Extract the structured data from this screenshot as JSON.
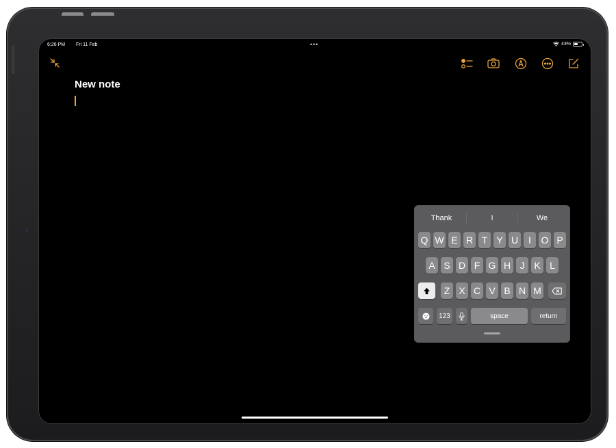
{
  "status_bar": {
    "time": "6:26 PM",
    "date": "Fri 11 Feb",
    "battery": "43%",
    "battery_level": 0.43
  },
  "toolbar": {
    "icons": [
      "checklist-icon",
      "camera-icon",
      "markup-icon",
      "more-icon",
      "compose-icon"
    ]
  },
  "note": {
    "title": "New note"
  },
  "keyboard": {
    "suggestions": [
      "Thank",
      "I",
      "We"
    ],
    "rows": [
      [
        "Q",
        "W",
        "E",
        "R",
        "T",
        "Y",
        "U",
        "I",
        "O",
        "P"
      ],
      [
        "A",
        "S",
        "D",
        "F",
        "G",
        "H",
        "J",
        "K",
        "L"
      ],
      [
        "Z",
        "X",
        "C",
        "V",
        "B",
        "N",
        "M"
      ]
    ],
    "numbers_label": "123",
    "space_label": "space",
    "return_label": "return"
  },
  "colors": {
    "accent": "#e8a33d",
    "screen_bg": "#000000",
    "keyboard_bg": "#5b5b5d",
    "key_bg": "#8a8a8c"
  }
}
